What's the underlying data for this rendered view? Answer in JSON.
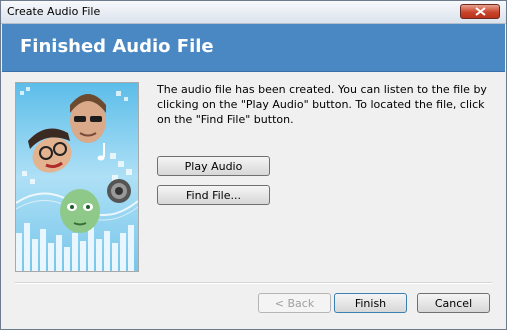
{
  "window": {
    "title": "Create Audio File"
  },
  "header": {
    "title": "Finished Audio File"
  },
  "main": {
    "description": "The audio file has been created.  You can listen to the file by clicking on the \"Play Audio\" button.  To located the file, click on the \"Find File\" button.",
    "play_label": "Play Audio",
    "find_label": "Find File..."
  },
  "footer": {
    "back_label": "< Back",
    "finish_label": "Finish",
    "cancel_label": "Cancel"
  },
  "colors": {
    "banner": "#4a88c4",
    "close_button": "#c9452c"
  },
  "icons": {
    "close": "close-icon",
    "artwork": "audio-faces-artwork"
  }
}
